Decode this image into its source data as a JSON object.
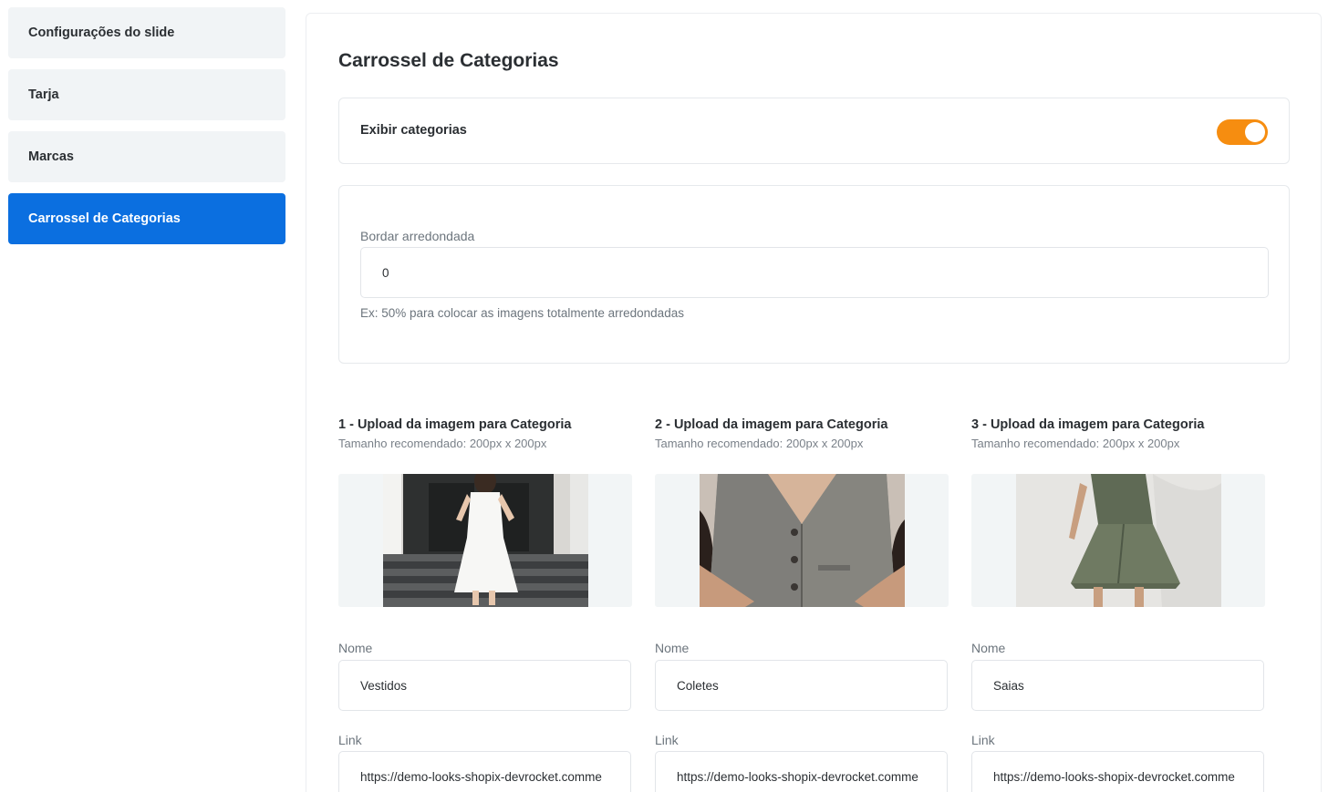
{
  "sidebar": {
    "items": [
      {
        "label": "Configurações do slide",
        "active": false
      },
      {
        "label": "Tarja",
        "active": false
      },
      {
        "label": "Marcas",
        "active": false
      },
      {
        "label": "Carrossel de Categorias",
        "active": true
      }
    ]
  },
  "main": {
    "title": "Carrossel de Categorias",
    "show_categories": {
      "label": "Exibir categorias",
      "enabled": true
    },
    "border": {
      "label": "Bordar arredondada",
      "value": "0",
      "helper": "Ex: 50% para colocar as imagens totalmente arredondadas"
    },
    "uploads": [
      {
        "title": "1 - Upload da imagem para Categoria",
        "subtitle": "Tamanho recomendado: 200px x 200px",
        "image": "white-dress-photo",
        "name_label": "Nome",
        "name_value": "Vestidos",
        "link_label": "Link",
        "link_value": "https://demo-looks-shopix-devrocket.comme"
      },
      {
        "title": "2 - Upload da imagem para Categoria",
        "subtitle": "Tamanho recomendado: 200px x 200px",
        "image": "gray-vest-photo",
        "name_label": "Nome",
        "name_value": "Coletes",
        "link_label": "Link",
        "link_value": "https://demo-looks-shopix-devrocket.comme"
      },
      {
        "title": "3 - Upload da imagem para Categoria",
        "subtitle": "Tamanho recomendado: 200px x 200px",
        "image": "green-skirt-photo",
        "name_label": "Nome",
        "name_value": "Saias",
        "link_label": "Link",
        "link_value": "https://demo-looks-shopix-devrocket.comme"
      }
    ]
  },
  "colors": {
    "accent": "#0b6fe0",
    "toggle_on": "#f68d10",
    "sidebar_bg": "#f1f4f6"
  }
}
